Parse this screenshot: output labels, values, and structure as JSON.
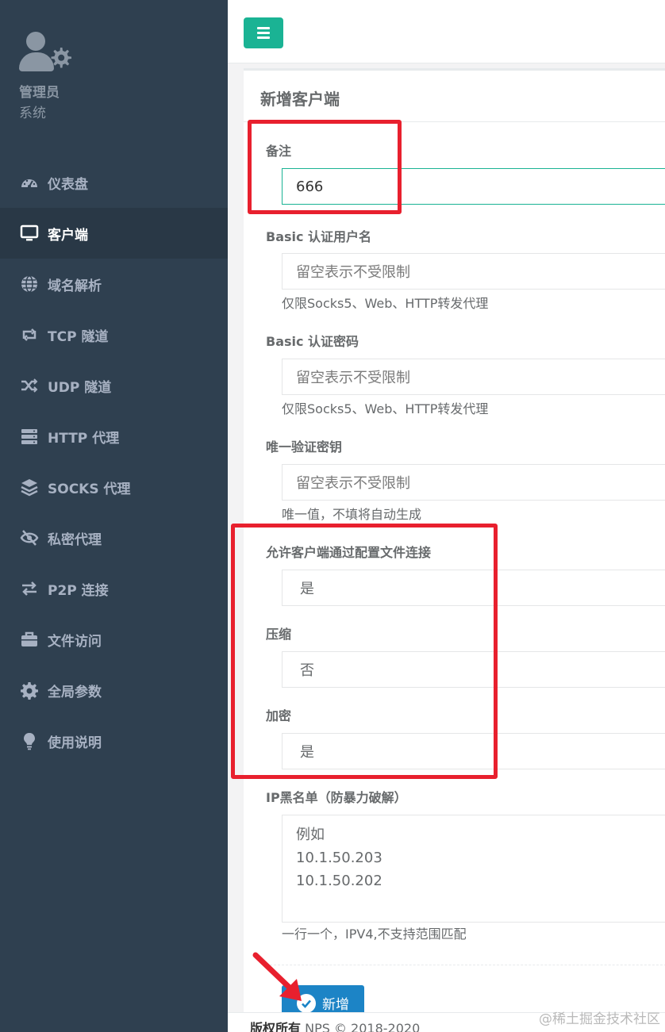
{
  "sidebar": {
    "user_name": "管理员",
    "user_role": "系统",
    "items": [
      {
        "label": "仪表盘",
        "icon": "dashboard-icon"
      },
      {
        "label": "客户端",
        "icon": "desktop-icon",
        "active": true
      },
      {
        "label": "域名解析",
        "icon": "globe-icon"
      },
      {
        "label": "TCP 隧道",
        "icon": "retweet-icon"
      },
      {
        "label": "UDP 隧道",
        "icon": "random-icon"
      },
      {
        "label": "HTTP 代理",
        "icon": "server-icon"
      },
      {
        "label": "SOCKS 代理",
        "icon": "layers-icon"
      },
      {
        "label": "私密代理",
        "icon": "eye-slash-icon"
      },
      {
        "label": "P2P 连接",
        "icon": "exchange-icon"
      },
      {
        "label": "文件访问",
        "icon": "briefcase-icon"
      },
      {
        "label": "全局参数",
        "icon": "gear-icon"
      },
      {
        "label": "使用说明",
        "icon": "lightbulb-icon"
      }
    ]
  },
  "form": {
    "title": "新增客户端",
    "remark_label": "备注",
    "remark_value": "666",
    "basic_user_label": "Basic 认证用户名",
    "basic_user_placeholder": "留空表示不受限制",
    "basic_user_help": "仅限Socks5、Web、HTTP转发代理",
    "basic_pass_label": "Basic 认证密码",
    "basic_pass_placeholder": "留空表示不受限制",
    "basic_pass_help": "仅限Socks5、Web、HTTP转发代理",
    "vkey_label": "唯一验证密钥",
    "vkey_placeholder": "留空表示不受限制",
    "vkey_help": "唯一值，不填将自动生成",
    "config_conn_label": "允许客户端通过配置文件连接",
    "config_conn_value": "是",
    "compress_label": "压缩",
    "compress_value": "否",
    "crypt_label": "加密",
    "crypt_value": "是",
    "blacklist_label": "IP黑名单（防暴力破解）",
    "blacklist_lines": [
      "例如",
      "10.1.50.203",
      "10.1.50.202"
    ],
    "blacklist_help": "一行一个，IPV4,不支持范围匹配",
    "submit_label": "新增"
  },
  "footer": {
    "copyright_bold": "版权所有",
    "copyright_rest": " NPS © 2018-2020"
  },
  "watermark": "@稀土掘金技术社区",
  "colors": {
    "sidebar_bg": "#2f4050",
    "primary": "#1ab394",
    "submit": "#1c84c6",
    "annotation": "#e8202e"
  }
}
